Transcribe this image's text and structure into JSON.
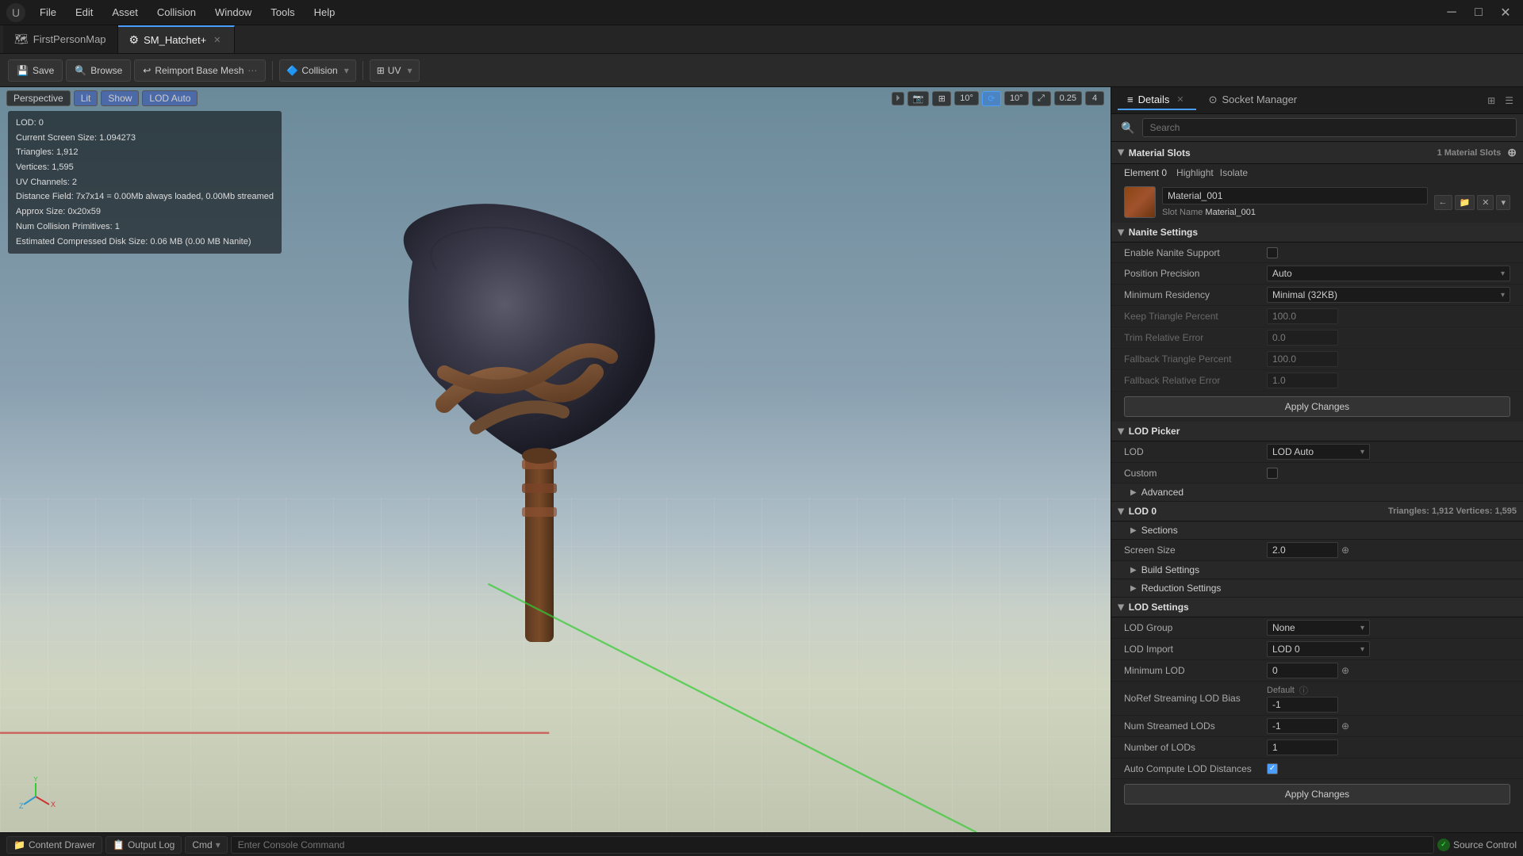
{
  "titlebar": {
    "logo": "U",
    "menu": [
      "File",
      "Edit",
      "Asset",
      "Collision",
      "Window",
      "Tools",
      "Help"
    ],
    "win_buttons": [
      "─",
      "□",
      "✕"
    ]
  },
  "tabs": [
    {
      "id": "first-person-map",
      "icon": "🗺",
      "label": "FirstPersonMap",
      "active": false,
      "closable": false
    },
    {
      "id": "sm-hatchet",
      "icon": "⚙",
      "label": "SM_Hatchet+",
      "active": true,
      "closable": true
    }
  ],
  "toolbar": {
    "save_label": "Save",
    "browse_label": "Browse",
    "reimport_label": "Reimport Base Mesh",
    "collision_label": "Collision",
    "uv_label": "UV"
  },
  "viewport": {
    "mode_btns": [
      "Perspective",
      "Lit",
      "Show",
      "LOD Auto"
    ],
    "tool_values": [
      "10°",
      "10°",
      "0.25",
      "4"
    ],
    "stats": [
      "LOD: 0",
      "Current Screen Size: 1.094273",
      "Triangles: 1,912",
      "Vertices: 1,595",
      "UV Channels: 2",
      "Distance Field: 7x7x14 = 0.00Mb always loaded, 0.00Mb streamed",
      "Approx Size: 0x20x59",
      "Num Collision Primitives: 1",
      "Estimated Compressed Disk Size: 0.06 MB (0.00 MB Nanite)"
    ]
  },
  "details_panel": {
    "title": "Details",
    "socket_manager_label": "Socket Manager",
    "search_placeholder": "Search",
    "sections": {
      "material_slots": {
        "label": "Material Slots",
        "header_right": "1 Material Slots",
        "element0": "Element 0",
        "highlight": "Highlight",
        "isolate": "Isolate",
        "material_name": "Material_001",
        "slot_name": "Material_001"
      },
      "nanite_settings": {
        "label": "Nanite Settings",
        "enable_nanite_label": "Enable Nanite Support",
        "position_precision_label": "Position Precision",
        "position_precision_value": "Auto",
        "minimum_residency_label": "Minimum Residency",
        "minimum_residency_value": "Minimal (32KB)",
        "keep_triangle_label": "Keep Triangle Percent",
        "keep_triangle_value": "100.0",
        "trim_relative_label": "Trim Relative Error",
        "trim_relative_value": "0.0",
        "fallback_triangle_label": "Fallback Triangle Percent",
        "fallback_triangle_value": "100.0",
        "fallback_relative_label": "Fallback Relative Error",
        "fallback_relative_value": "1.0",
        "apply_btn": "Apply Changes"
      },
      "lod_picker": {
        "label": "LOD Picker",
        "lod_label": "LOD",
        "lod_value": "LOD Auto",
        "custom_label": "Custom",
        "advanced_label": "Advanced"
      },
      "lod0": {
        "label": "LOD 0",
        "triangles_info": "Triangles: 1,912  Vertices: 1,595",
        "sections_label": "Sections",
        "screen_size_label": "Screen Size",
        "screen_size_value": "2.0",
        "build_settings_label": "Build Settings",
        "reduction_settings_label": "Reduction Settings"
      },
      "lod_settings": {
        "label": "LOD Settings",
        "lod_group_label": "LOD Group",
        "lod_group_value": "None",
        "lod_import_label": "LOD Import",
        "lod_import_value": "LOD 0",
        "minimum_lod_label": "Minimum LOD",
        "minimum_lod_value": "0",
        "no_ref_streaming_label": "NoRef Streaming LOD Bias",
        "no_ref_default": "Default",
        "no_ref_value": "-1",
        "num_streamed_lods_label": "Num Streamed LODs",
        "num_streamed_lods_value": "-1",
        "number_of_lods_label": "Number of LODs",
        "number_of_lods_value": "1",
        "auto_compute_label": "Auto Compute LOD Distances",
        "auto_compute_checked": true,
        "apply_btn": "Apply Changes"
      }
    }
  },
  "bottombar": {
    "content_drawer": "Content Drawer",
    "output_log": "Output Log",
    "cmd_label": "Cmd",
    "cmd_placeholder": "Enter Console Command",
    "source_control": "Source Control"
  }
}
